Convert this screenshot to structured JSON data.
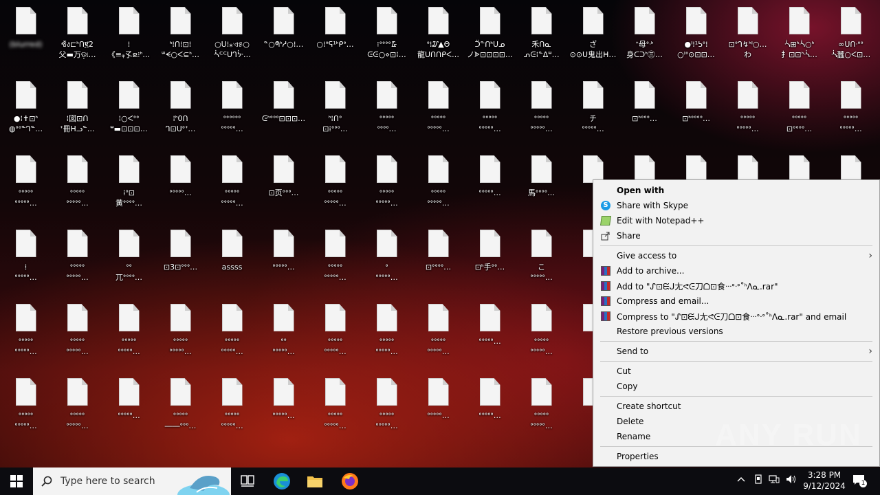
{
  "desktop": {
    "rows": [
      [
        "(blurred)",
        "ซ้ง⊏ᑋᑎ፪2\n父▬万ଡ଼ା…",
        "⁞\n《≡ᵩ孓ຂ⁝ᑋ…",
        "ᑋ⁞ᑎ⁞⊡⁞\nᐜᗕ○ᐸ⊆ᑋ…",
        "○ᑌ⁞⁎ଏ୫○\nᔂᒼᒼᑌᒉᔼ…",
        "ᓐ○ᖗᑋᓱ○⁞…",
        "○⁞ᐤᕋ¹ᑋᑭᐤ…",
        "⁝ᐤᐤᐤᐤ᮹\nᕮᕮ○⋄⊡⁞…",
        "ᐤ⁞᮸▲Θ\n龍ᑌᑎᑎᑭᐸ…",
        "ᑒᓐᑎᑋᑌᓄ\nノᗎ⊡⊡⊡⊡…",
        "禾ᑎᓇ\nᕄᕮ⁞ᓐᐃᐜ…",
        "ざ\n⊙⊙ᑌ鬼出ᕼ…",
        "ᐩ母ᐤᐧᑋ\n身ᑕᑐᑋ㊂…",
        "●ᑊ⁞¹ᕊᐤ⁞\n○ᑊᐤ⊙⊡⊡…",
        "⊡ᐤᒉ↯ᑋᑊ○…\nわ",
        "ᔂ⊞ᑋᔂ○ᑋ\n扌⊡⊡ᑋᔂ…",
        "∞ᑌᑎᐧᐤᐤ\nᔂ蠶○ᐸ⊡…"
      ],
      [
        "●⁞✝⊡ᑋ\n◍ᐤᐤᓐᒉᓐ…",
        "⁞図⊡ᑎ\nᐩ冊ᕼᓗᓐ…",
        "⁞○ᐸᐤᐤ\nᐜ▬⊡⊡⊡…",
        "⁞ᑋ0ᑎ\nᒉ⊡ᑌᐤᐩ…",
        "ᐤᐤᐤᐤᐤᐤ\nᐤᐤᐤᐤᐤ…",
        "ᕮᑋᐤᐤᐤ⊡⊡⊡…",
        "ᑋ⁞ᑎᐤ\n⊡⁞ᐤᐤᐤ…",
        "ᐤᐤᐤᐤᐤ\nᐤᐤᐤᐤ…",
        "ᐤᐤᐤᐤᐤ\nᐤᐤᐤᐤᐤ…",
        "ᐤᐤᐤᐤᐤ\nᐤᐤᐤᐤᐤ…",
        "ᐤᐤᐤᐤᐤ\nᐤᐤᐤᐤᐤ…",
        "チ\nᐤᐤᐤᐤᐤ…",
        "⊡ᑋᐤᐤᐤ…",
        "⊡ᑋᐤᐤᐤᐤ…",
        "ᐤᐤᐤᐤᐤ\nᐤᐤᐤᐤᐤ…",
        "ᐤᐤᐤᐤᐤ\n⊡ᐤᐤᐤᐤ…",
        "ᐤᐤᐤᐤᐤ\nᐤᐤᐤᐤᐤ…"
      ],
      [
        "ᐤᐤᐤᐤᐤ\nᐤᐤᐤᐤᐤ…",
        "ᐤᐤᐤᐤᐤ\nᐤᐤᐤᐤᐤ…",
        "⁞ᐤ⊡\n黄ᐤᐤᐤᐤ…",
        "ᐤᐤᐤᐤᐤ…",
        "ᐤᐤᐤᐤᐤ\nᐤᐤᐤᐤᐤ…",
        "⊡页ᐤᐤᐤ…",
        "ᐤᐤᐤᐤᐤ\nᐤᐤᐤᐤᐤ…",
        "ᐤᐤᐤᐤᐤ\nᐤᐤᐤᐤᐤ…",
        "ᐤᐤᐤᐤᐤ\nᐤᐤᐤᐤᐤ…",
        "ᐤᐤᐤᐤᐤ…",
        "馬ᐤᐤᐤᐤ…",
        "",
        "",
        "",
        "",
        "",
        ""
      ],
      [
        "⁞\nᐤᐤᐤᐤᐤ…",
        "ᐤᐤᐤᐤᐤ\nᐤᐤᐤᐤᐤ…",
        "ᐤᐤ\n兀ᐤᐤᐤᐤ…",
        "⊡3⊡ᐤᐤᐤ…",
        "assss",
        "ᐤᐤᐤᐤᐤ…",
        "ᐤᐤᐤᐤᐤ\nᐤᐤᐤᐤᐤ…",
        "ᐤ\nᐤᐤᐤᐤᐤ…",
        "⊡ᐤᐤᐤᐤ…",
        "⊡ᑋ手ᐤᐤ…",
        "こ\nᐤᐤᐤᐤᐤ…",
        "",
        "",
        "",
        "",
        "",
        ""
      ],
      [
        "ᐤᐤᐤᐤᐤ\nᐤᐤᐤᐤᐤ…",
        "ᐤᐤᐤᐤᐤ\nᐤᐤᐤᐤᐤ…",
        "ᐤᐤᐤᐤᐤ\nᐤᐤᐤᐤᐤ…",
        "ᐤᐤᐤᐤᐤ\nᐤᐤᐤᐤᐤ…",
        "ᐤᐤᐤᐤᐤ\nᐤᐤᐤᐤᐤ…",
        "ᐤᐤ\nᐤᐤᐤᐤᐤ…",
        "ᐤᐤᐤᐤᐤ\nᐤᐤᐤᐤᐤ…",
        "ᐤᐤᐤᐤᐤ\nᐤᐤᐤᐤᐤ…",
        "ᐤᐤᐤᐤᐤ\nᐤᐤᐤᐤᐤ…",
        "ᐤᐤᐤᐤᐤ…",
        "ᐤᐤᐤᐤᐤ\nᐤᐤᐤᐤᐤ…",
        "",
        "",
        "",
        "",
        "",
        ""
      ],
      [
        "ᐤᐤᐤᐤᐤ\nᐤᐤᐤᐤᐤ…",
        "ᐤᐤᐤᐤᐤ\nᐤᐤᐤᐤᐤ…",
        "ᐤᐤᐤᐤᐤ…",
        "ᐤᐤᐤᐤᐤ\n――ᐤᐤᐤ…",
        "ᐤᐤᐤᐤᐤ\nᐤᐤᐤᐤᐤ…",
        "ᐤᐤᐤᐤᐤ…",
        "ᐤᐤᐤᐤᐤ\nᐤᐤᐤᐤᐤ…",
        "ᐤᐤᐤᐤᐤ\nᐤᐤᐤᐤᐤ…",
        "ᐤᐤᐤᐤᐤ…",
        "ᐤᐤᐤᐤᐤ…",
        "ᐤᐤᐤᐤᐤ\nᐤᐤᐤᐤᐤ…",
        "",
        "",
        "",
        "",
        "",
        ""
      ]
    ]
  },
  "context_menu": {
    "items": [
      {
        "type": "item",
        "label": "Open with",
        "bold": true,
        "icon": "none"
      },
      {
        "type": "item",
        "label": "Share with Skype",
        "icon": "skype-icon"
      },
      {
        "type": "item",
        "label": "Edit with Notepad++",
        "icon": "notepad-plus-plus-icon"
      },
      {
        "type": "item",
        "label": "Share",
        "icon": "share-icon"
      },
      {
        "type": "separator"
      },
      {
        "type": "item",
        "label": "Give access to",
        "icon": "none",
        "submenu": true
      },
      {
        "type": "item",
        "label": "Add to archive...",
        "icon": "winrar-icon"
      },
      {
        "type": "item",
        "label": "Add to \"ᔑ⊡ᙓᒍ尢ᕙᕮ刀ᗝ⊡食ᐧᐧᐧᐤᐧᐤ˚ᑋᐱᓇ.rar\"",
        "icon": "winrar-icon"
      },
      {
        "type": "item",
        "label": "Compress and email...",
        "icon": "winrar-icon"
      },
      {
        "type": "item",
        "label": "Compress to \"ᔑ⊡ᙓᒍ尢ᕙᕮ刀ᗝ⊡食ᐧᐧᐧᐤᐧᐤ˚ᑋᐱᓇ.rar\" and email",
        "icon": "winrar-icon"
      },
      {
        "type": "item",
        "label": "Restore previous versions",
        "icon": "none"
      },
      {
        "type": "separator"
      },
      {
        "type": "item",
        "label": "Send to",
        "icon": "none",
        "submenu": true
      },
      {
        "type": "separator"
      },
      {
        "type": "item",
        "label": "Cut",
        "icon": "none"
      },
      {
        "type": "item",
        "label": "Copy",
        "icon": "none"
      },
      {
        "type": "separator"
      },
      {
        "type": "item",
        "label": "Create shortcut",
        "icon": "none"
      },
      {
        "type": "item",
        "label": "Delete",
        "icon": "none"
      },
      {
        "type": "item",
        "label": "Rename",
        "icon": "none"
      },
      {
        "type": "separator"
      },
      {
        "type": "item",
        "label": "Properties",
        "icon": "none"
      }
    ],
    "submenu_arrow": "›"
  },
  "watermark": {
    "text": "ANY RUN"
  },
  "taskbar": {
    "search_placeholder": "Type here to search",
    "pinned": [
      "task-view-icon",
      "edge-icon",
      "file-explorer-icon",
      "firefox-icon"
    ],
    "clock_time": "3:28 PM",
    "clock_date": "9/12/2024",
    "tray_icons": [
      "chevron-up-icon",
      "device-icon",
      "network-icon",
      "volume-icon"
    ],
    "notification_count": "1"
  },
  "colors": {
    "menu_bg": "#f2f2f2",
    "taskbar_bg": "#0c0c10",
    "search_bg": "#f3f3f3"
  }
}
